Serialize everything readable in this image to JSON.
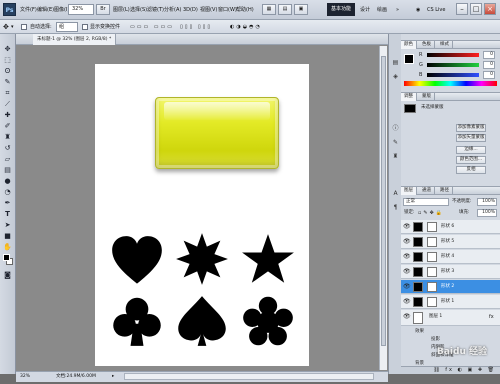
{
  "app": {
    "logo": "Ps",
    "menu": [
      "文件(F)",
      "编辑(E)",
      "图像(I)",
      "图层(L)",
      "选择(S)",
      "滤镜(T)",
      "分析(A)",
      "3D(D)",
      "视图(V)",
      "窗口(W)",
      "帮助(H)"
    ],
    "zoom": "32%",
    "workspace_active": "基本功能",
    "workspace_links": [
      "设计",
      "绘画"
    ],
    "cslive": "CS Live",
    "window_buttons": [
      "–",
      "□",
      "×"
    ]
  },
  "options": {
    "auto_select_label": "自动选择:",
    "auto_select_value": "组",
    "show_transform_label": "显示变换控件"
  },
  "document": {
    "tab_label": "未标题-1 @ 32% (图层 2, RGB/8) *",
    "status_zoom": "32%",
    "status_doc": "文档:24.9M/6.00M"
  },
  "panels": {
    "color_tabs": [
      "颜色",
      "色板",
      "样式"
    ],
    "color_rows": [
      {
        "letter": "R",
        "value": "0",
        "color": "#e03030"
      },
      {
        "letter": "G",
        "value": "0",
        "color": "#20b040"
      },
      {
        "letter": "B",
        "value": "0",
        "color": "#3050e0"
      }
    ],
    "adjust_tabs": [
      "调整",
      "蒙版"
    ],
    "adjust_label": "未选择蒙版",
    "adjust_buttons": [
      "添加像素蒙版",
      "添加矢量蒙版",
      "边缘...",
      "颜色范围...",
      "反相"
    ],
    "layers_tabs": [
      "图层",
      "通道",
      "路径"
    ],
    "blend_mode": "正常",
    "opacity_label": "不透明度:",
    "opacity_value": "100%",
    "lock_label": "锁定:",
    "fill_label": "填充:",
    "fill_value": "100%",
    "layers": [
      {
        "name": "形状 6",
        "selected": false
      },
      {
        "name": "形状 5",
        "selected": false
      },
      {
        "name": "形状 4",
        "selected": false
      },
      {
        "name": "形状 3",
        "selected": false
      },
      {
        "name": "形状 2",
        "selected": true
      },
      {
        "name": "形状 1",
        "selected": false
      }
    ],
    "image_layer": {
      "name": "图层 1",
      "fx": "fx"
    },
    "effects": [
      "效果",
      "投影",
      "内阴影",
      "斜面和浮雕",
      "背景"
    ],
    "watermark": "Baidu 经验"
  },
  "tools": [
    "move",
    "marquee",
    "lasso",
    "quick-select",
    "crop",
    "eyedropper",
    "healing",
    "brush",
    "clone",
    "history",
    "eraser",
    "gradient",
    "blur",
    "dodge",
    "pen",
    "type",
    "path-select",
    "shape",
    "3d-rotate",
    "3d-orbit",
    "hand",
    "zoom"
  ]
}
